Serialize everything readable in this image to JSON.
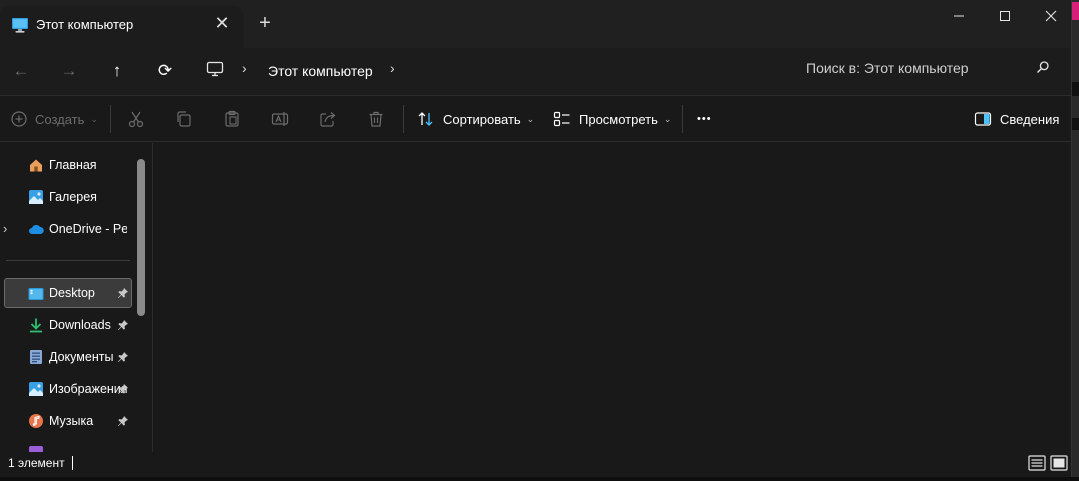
{
  "window": {
    "tab_title": "Этот компьютер",
    "controls": {
      "minimize": "—",
      "maximize": "☐",
      "close": "✕"
    }
  },
  "tabs": {
    "close_glyph": "✕",
    "new_tab_glyph": "+"
  },
  "nav": {
    "back_glyph": "←",
    "forward_glyph": "→",
    "up_glyph": "↑",
    "refresh_glyph": "⟳"
  },
  "breadcrumb": {
    "location": "Этот компьютер",
    "chevron": "›"
  },
  "search": {
    "placeholder": "Поиск в: Этот компьютер"
  },
  "commandbar": {
    "create_label": "Создать",
    "sort_label": "Сортировать",
    "view_label": "Просмотреть",
    "more_glyph": "•••",
    "details_label": "Сведения",
    "dropdown_glyph": "⌄"
  },
  "sidebar": {
    "items": [
      {
        "label": "Главная",
        "icon": "home-icon"
      },
      {
        "label": "Галерея",
        "icon": "gallery-icon"
      },
      {
        "label": "OneDrive - Personal",
        "icon": "onedrive-icon"
      },
      {
        "label": "Desktop",
        "icon": "desktop-icon",
        "pinned": true,
        "selected": true
      },
      {
        "label": "Downloads",
        "icon": "downloads-icon",
        "pinned": true
      },
      {
        "label": "Документы",
        "icon": "documents-icon",
        "pinned": true
      },
      {
        "label": "Изображения",
        "icon": "pictures-icon",
        "pinned": true
      },
      {
        "label": "Музыка",
        "icon": "music-icon",
        "pinned": true
      }
    ],
    "expand_glyph": "›"
  },
  "status": {
    "item_count": "1 элемент"
  },
  "colors": {
    "accent": "#4cc2ff",
    "folder_blue": "#2a9bd8",
    "downloads_green": "#2fbf71",
    "music_orange": "#e8744a"
  }
}
